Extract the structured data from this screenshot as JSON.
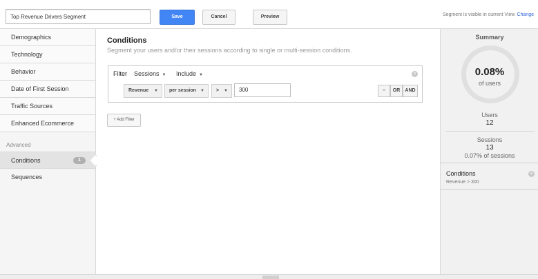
{
  "header": {
    "segment_name": "Top Revenue Drivers Segment",
    "save_label": "Save",
    "cancel_label": "Cancel",
    "preview_label": "Preview",
    "visibility_text": "Segment is visible in current View",
    "change_label": "Change"
  },
  "sidebar": {
    "items": [
      {
        "label": "Demographics"
      },
      {
        "label": "Technology"
      },
      {
        "label": "Behavior"
      },
      {
        "label": "Date of First Session"
      },
      {
        "label": "Traffic Sources"
      },
      {
        "label": "Enhanced Ecommerce"
      }
    ],
    "advanced_heading": "Advanced",
    "advanced_items": [
      {
        "label": "Conditions",
        "badge": "1"
      },
      {
        "label": "Sequences"
      }
    ]
  },
  "main": {
    "title": "Conditions",
    "description": "Segment your users and/or their sessions according to single or multi-session conditions.",
    "filter": {
      "label": "Filter",
      "scope": "Sessions",
      "mode": "Include",
      "dimension": "Revenue",
      "aggregation": "per session",
      "operator": ">",
      "value": "300",
      "remove_label": "–",
      "or_label": "OR",
      "and_label": "AND"
    },
    "add_filter_label": "+ Add Filter"
  },
  "summary": {
    "title": "Summary",
    "percent": "0.08%",
    "percent_sub": "of users",
    "users_label": "Users",
    "users_value": "12",
    "sessions_label": "Sessions",
    "sessions_value": "13",
    "sessions_sub": "0.07% of sessions",
    "conditions_title": "Conditions",
    "conditions_detail": "Revenue > 300"
  },
  "colors": {
    "accent": "#4285f4",
    "link": "#3367d6"
  },
  "icons": {
    "close": "close-icon",
    "caret": "caret-down-icon"
  }
}
